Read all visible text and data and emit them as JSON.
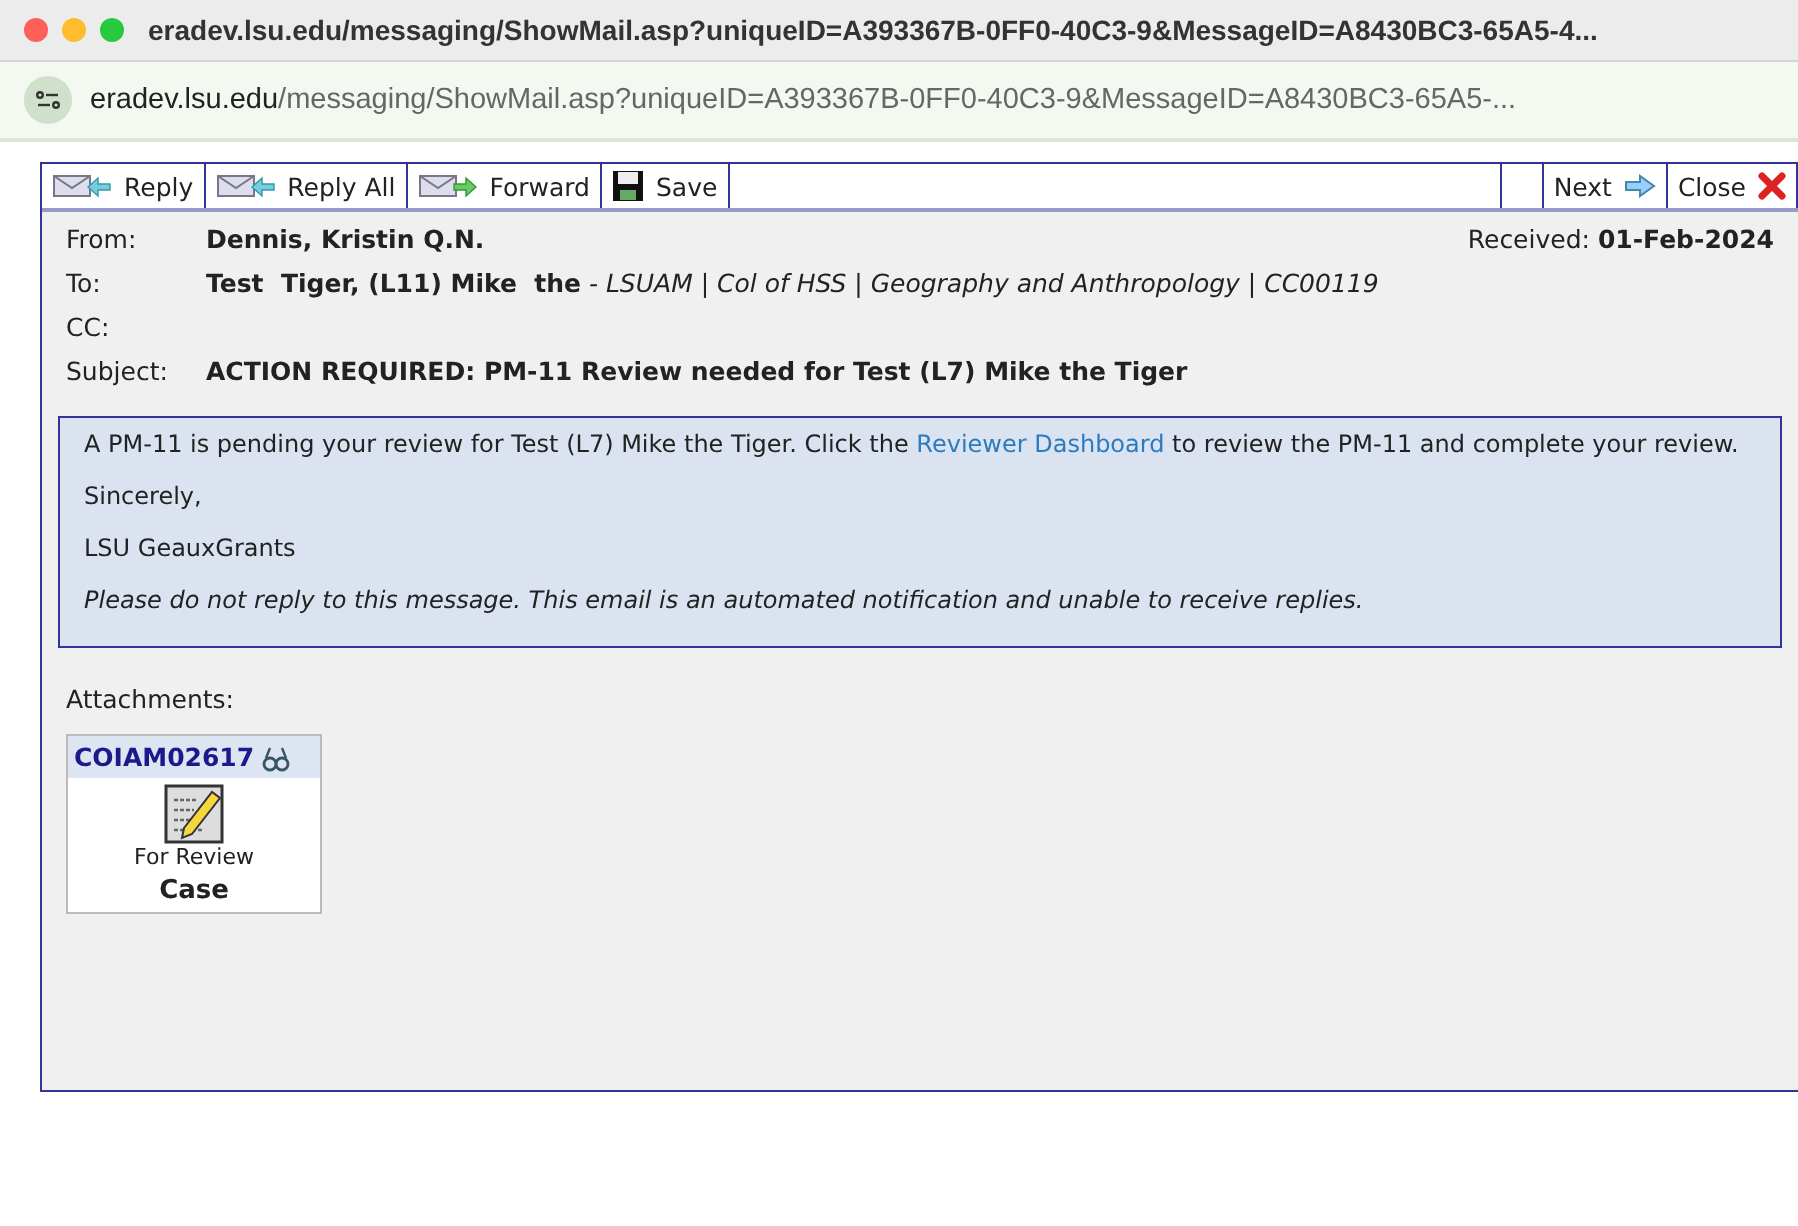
{
  "window": {
    "title": "eradev.lsu.edu/messaging/ShowMail.asp?uniqueID=A393367B-0FF0-40C3-9&MessageID=A8430BC3-65A5-4..."
  },
  "address_bar": {
    "host": "eradev.lsu.edu",
    "path": "/messaging/ShowMail.asp?uniqueID=A393367B-0FF0-40C3-9&MessageID=A8430BC3-65A5-..."
  },
  "toolbar": {
    "left": [
      {
        "label": "Reply",
        "kind": "reply"
      },
      {
        "label": "Reply All",
        "kind": "replyall"
      },
      {
        "label": "Forward",
        "kind": "forward"
      },
      {
        "label": "Save",
        "kind": "save"
      }
    ],
    "right": [
      {
        "label": "Next",
        "kind": "next"
      },
      {
        "label": "Close",
        "kind": "close"
      }
    ]
  },
  "header": {
    "from_label": "From:",
    "from": "Dennis, Kristin Q.N.",
    "received_label": "Received:",
    "received": "01-Feb-2024",
    "to_label": "To:",
    "to": "**Test  Tiger, (L11) Mike  the** *- LSUAM | Col of HSS | Geography and Anthropology | CC00119*",
    "cc_label": "CC:",
    "subject_label": "Subject:",
    "subject": "ACTION REQUIRED: PM-11 Review needed for Test (L7) Mike the Tiger"
  },
  "body": {
    "intro_before": "A PM-11 is pending your review for Test (L7) Mike the Tiger. Click the ",
    "link": "Reviewer Dashboard",
    "intro_after": " to review the PM-11 and complete your review.",
    "closing": "Sincerely,",
    "signature": "LSU GeauxGrants",
    "notice": "Please do not reply to this message. This email is an automated notification and unable to receive replies."
  },
  "attachments": {
    "label": "Attachments:",
    "items": [
      {
        "id": "COIAM02617",
        "status": "For Review",
        "type": "Case"
      }
    ]
  }
}
